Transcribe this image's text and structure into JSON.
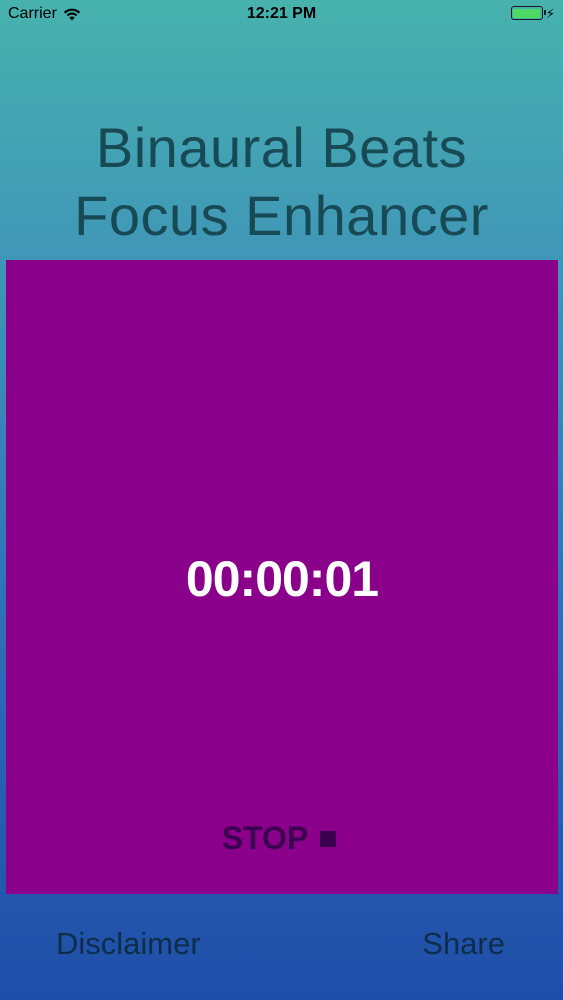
{
  "status_bar": {
    "carrier": "Carrier",
    "time": "12:21 PM",
    "battery_level": 1.0,
    "icons": [
      "wifi-icon",
      "battery-icon",
      "charging-icon"
    ]
  },
  "app": {
    "title_line1": "Binaural Beats",
    "title_line2": "Focus Enhancer"
  },
  "player": {
    "timer": "00:00:01",
    "stop_label": "STOP"
  },
  "bottom_bar": {
    "disclaimer_label": "Disclaimer",
    "share_label": "Share"
  },
  "colors": {
    "panel": "#8b008b",
    "title_text": "#184a56",
    "stop_text": "#3d0050",
    "battery_fill": "#4cd964",
    "gradient_top": "#47b2ad",
    "gradient_bottom": "#1f4ea8"
  }
}
